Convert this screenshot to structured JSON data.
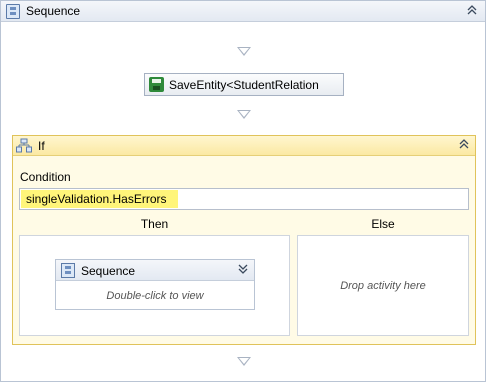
{
  "sequence": {
    "title": "Sequence",
    "collapse_glyph": "⌃",
    "icon": "sequence-icon"
  },
  "save_activity": {
    "label": "SaveEntity<StudentRelation",
    "icon": "save-floppy-icon"
  },
  "if_activity": {
    "title": "If",
    "collapse_glyph": "⌃",
    "icon": "if-branch-icon",
    "condition_label": "Condition",
    "condition_value": "singleValidation.HasErrors",
    "then_label": "Then",
    "else_label": "Else",
    "else_hint": "Drop activity here",
    "then_sequence": {
      "title": "Sequence",
      "expand_glyph": "⌄",
      "hint": "Double-click to view"
    }
  },
  "colors": {
    "highlight": "#fff57a",
    "if_border": "#e0c35a",
    "if_header": "#fbe9a3",
    "save_icon": "#2f8a3a"
  }
}
